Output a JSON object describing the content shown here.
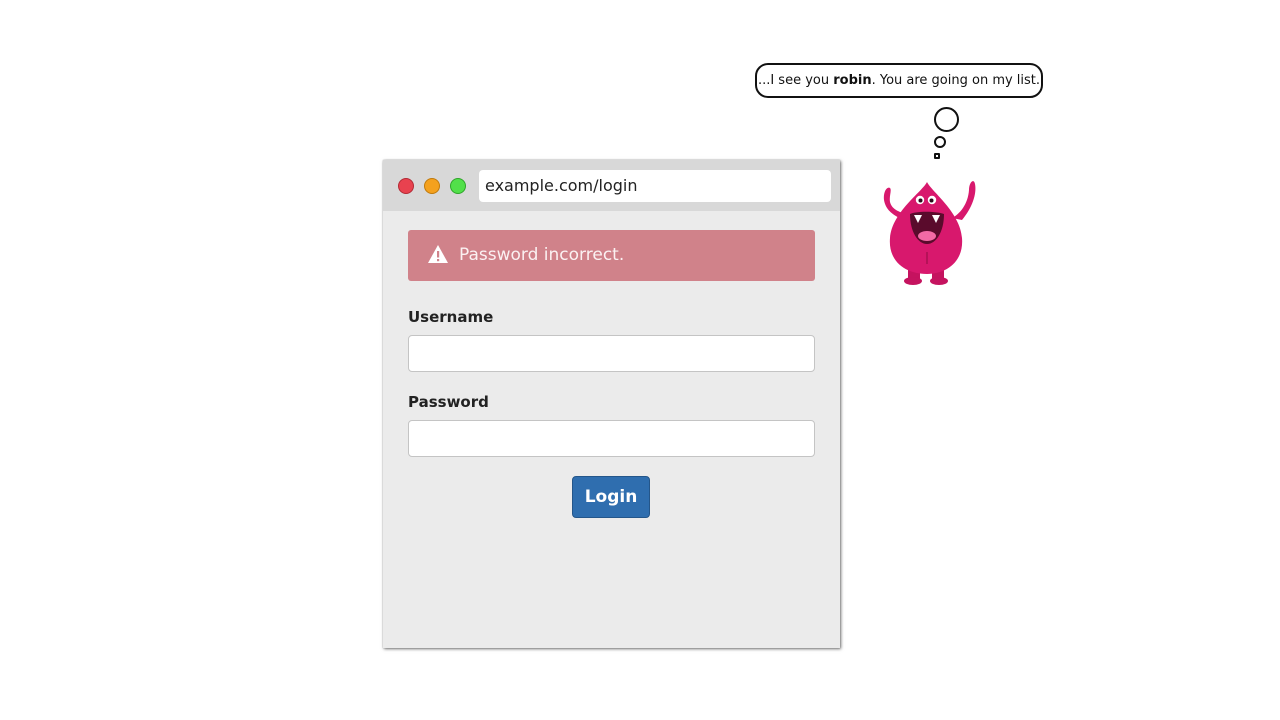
{
  "browser": {
    "url": "example.com/login",
    "traffic_lights": {
      "close_color": "#e8424f",
      "minimize_color": "#f4a11e",
      "maximize_color": "#52e04a"
    }
  },
  "login_form": {
    "error_message": "Password incorrect.",
    "error_icon": "warning-icon",
    "username_label": "Username",
    "username_value": "",
    "password_label": "Password",
    "password_value": "",
    "login_button_label": "Login"
  },
  "thought_bubble": {
    "prefix": "...I see you ",
    "name": "robin",
    "suffix": ". You are going on my list."
  },
  "colors": {
    "alert_background": "#d0828a",
    "button_primary": "#2f6eaf",
    "monster_pink": "#d8186d"
  }
}
